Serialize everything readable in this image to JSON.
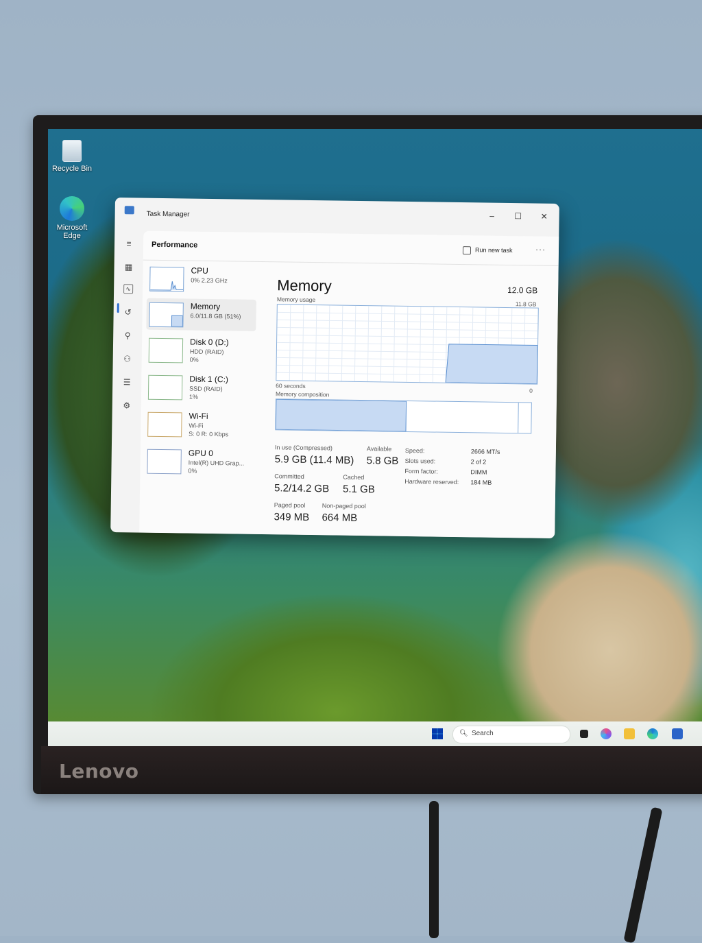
{
  "monitor": {
    "brand": "Lenovo"
  },
  "desktop": {
    "icons": [
      {
        "label": "Recycle Bin"
      },
      {
        "label": "Microsoft Edge"
      }
    ]
  },
  "window": {
    "title": "Task Manager",
    "controls": {
      "minimize": "–",
      "maximize": "☐",
      "close": "✕"
    }
  },
  "header": {
    "page_title": "Performance",
    "run_new_task": "Run new task",
    "more": "···"
  },
  "resources": [
    {
      "name": "CPU",
      "line1": "0% 2.23 GHz",
      "line2": ""
    },
    {
      "name": "Memory",
      "line1": "6.0/11.8 GB (51%)",
      "line2": ""
    },
    {
      "name": "Disk 0 (D:)",
      "line1": "HDD (RAID)",
      "line2": "0%"
    },
    {
      "name": "Disk 1 (C:)",
      "line1": "SSD (RAID)",
      "line2": "1%"
    },
    {
      "name": "Wi-Fi",
      "line1": "Wi-Fi",
      "line2": "S: 0 R: 0 Kbps"
    },
    {
      "name": "GPU 0",
      "line1": "Intel(R) UHD Grap...",
      "line2": "0%"
    }
  ],
  "detail": {
    "title": "Memory",
    "total": "12.0 GB",
    "usage_label": "Memory usage",
    "usage_max": "11.8 GB",
    "time_label": "60 seconds",
    "zero_label": "0",
    "composition_label": "Memory composition",
    "usage_fraction": 0.51,
    "composition": {
      "in_use_fraction": 0.51,
      "standby_fraction": 0.44
    },
    "stats": {
      "in_use_label": "In use (Compressed)",
      "in_use_value": "5.9 GB (11.4 MB)",
      "available_label": "Available",
      "available_value": "5.8 GB",
      "committed_label": "Committed",
      "committed_value": "5.2/14.2 GB",
      "cached_label": "Cached",
      "cached_value": "5.1 GB",
      "paged_label": "Paged pool",
      "paged_value": "349 MB",
      "nonpaged_label": "Non-paged pool",
      "nonpaged_value": "664 MB"
    },
    "specs": [
      {
        "label": "Speed:",
        "value": "2666 MT/s"
      },
      {
        "label": "Slots used:",
        "value": "2 of 2"
      },
      {
        "label": "Form factor:",
        "value": "DIMM"
      },
      {
        "label": "Hardware reserved:",
        "value": "184 MB"
      }
    ]
  },
  "taskbar": {
    "search_placeholder": "Search"
  },
  "colors": {
    "accent": "#2f6fd0",
    "chart_line": "#8bb0db",
    "chart_fill": "#c7daf3"
  }
}
